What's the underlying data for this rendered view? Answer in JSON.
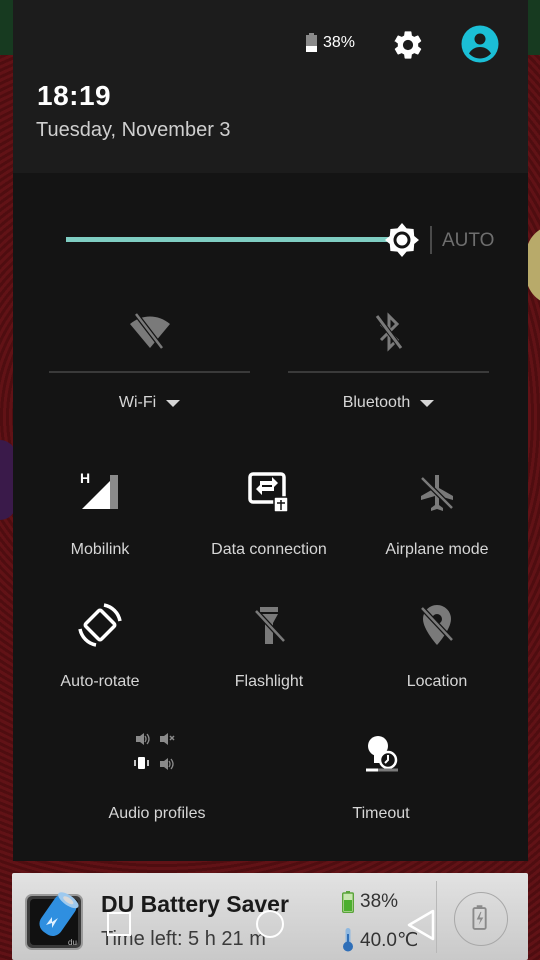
{
  "status": {
    "battery_percent_label": "38%",
    "battery_level": 0.38
  },
  "header": {
    "time": "18:19",
    "date": "Tuesday, November 3",
    "settings_icon": "gear-icon",
    "user_icon": "account-circle-icon",
    "accent_color": "#1bbfd6"
  },
  "brightness": {
    "level": 1.0,
    "auto_label": "AUTO",
    "track_color": "#7fcdc2"
  },
  "dual_tiles": [
    {
      "label": "Wi-Fi",
      "icon": "wifi-off-icon",
      "state": "off"
    },
    {
      "label": "Bluetooth",
      "icon": "bluetooth-off-icon",
      "state": "off"
    }
  ],
  "tiles": [
    {
      "label": "Mobilink",
      "icon": "cellular-signal-h-icon",
      "state": "on"
    },
    {
      "label": "Data connection",
      "icon": "data-connection-icon",
      "state": "on"
    },
    {
      "label": "Airplane mode",
      "icon": "airplane-off-icon",
      "state": "off"
    },
    {
      "label": "Auto-rotate",
      "icon": "auto-rotate-icon",
      "state": "on"
    },
    {
      "label": "Flashlight",
      "icon": "flashlight-off-icon",
      "state": "off"
    },
    {
      "label": "Location",
      "icon": "location-off-icon",
      "state": "off"
    },
    {
      "label": "Audio profiles",
      "icon": "audio-profiles-icon",
      "state": "on"
    },
    {
      "label": "Timeout",
      "icon": "screen-timeout-icon",
      "state": "on"
    }
  ],
  "notification": {
    "app_icon": "du-battery-icon",
    "title": "DU Battery Saver",
    "subtitle": "Time left: 5 h 21 m",
    "battery_label": "38%",
    "temperature_label": "40.0℃",
    "action_icon": "battery-charge-icon"
  },
  "navbar": {
    "recents_icon": "recents-square-icon",
    "home_icon": "home-circle-icon",
    "back_icon": "back-triangle-icon"
  }
}
